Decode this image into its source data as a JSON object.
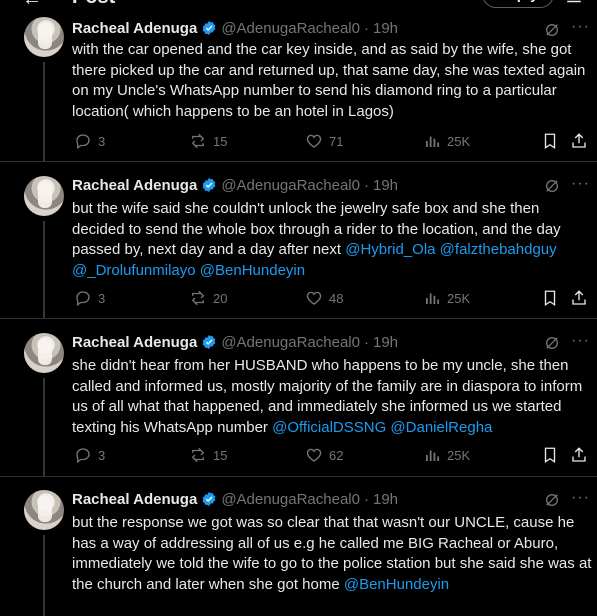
{
  "header": {
    "title": "Post",
    "reply_button": "Reply"
  },
  "tweets": [
    {
      "name": "Racheal Adenuga",
      "handle": "@AdenugaRacheal0",
      "time": "19h",
      "text": "with the car opened and the car key inside, and as said by the wife, she got there picked up the car and returned up, that same day, she was texted again on my Uncle's WhatsApp number to send his diamond ring to a particular location( which happens to be an hotel in Lagos)",
      "mentions": [],
      "stats": {
        "replies": "3",
        "reposts": "15",
        "likes": "71",
        "views": "25K"
      }
    },
    {
      "name": "Racheal Adenuga",
      "handle": "@AdenugaRacheal0",
      "time": "19h",
      "text": "but the wife said she couldn't unlock the jewelry safe box and she then decided to send the whole box through a rider to the location, and the day passed by, next day and a day after next ",
      "mentions": [
        "@Hybrid_Ola",
        "@falzthebahdguy",
        "@_Drolufunmilayo",
        "@BenHundeyin"
      ],
      "stats": {
        "replies": "3",
        "reposts": "20",
        "likes": "48",
        "views": "25K"
      }
    },
    {
      "name": "Racheal Adenuga",
      "handle": "@AdenugaRacheal0",
      "time": "19h",
      "text": "she didn't hear from her HUSBAND who happens to be my uncle, she then called and informed us, mostly majority of the family are in diaspora to inform us of all what that happened, and immediately she informed us we started texting his WhatsApp number ",
      "mentions": [
        "@OfficialDSSNG",
        "@DanielRegha"
      ],
      "stats": {
        "replies": "3",
        "reposts": "15",
        "likes": "62",
        "views": "25K"
      }
    },
    {
      "name": "Racheal Adenuga",
      "handle": "@AdenugaRacheal0",
      "time": "19h",
      "text": "but the response we got was so clear that that wasn't our UNCLE, cause he has a way of addressing all of us e.g he called me BIG Racheal or Aburo, immediately we told the wife to go to the police station but she said she was at the church and later when she got home ",
      "mentions": [
        "@BenHundeyin"
      ],
      "stats": {}
    }
  ]
}
